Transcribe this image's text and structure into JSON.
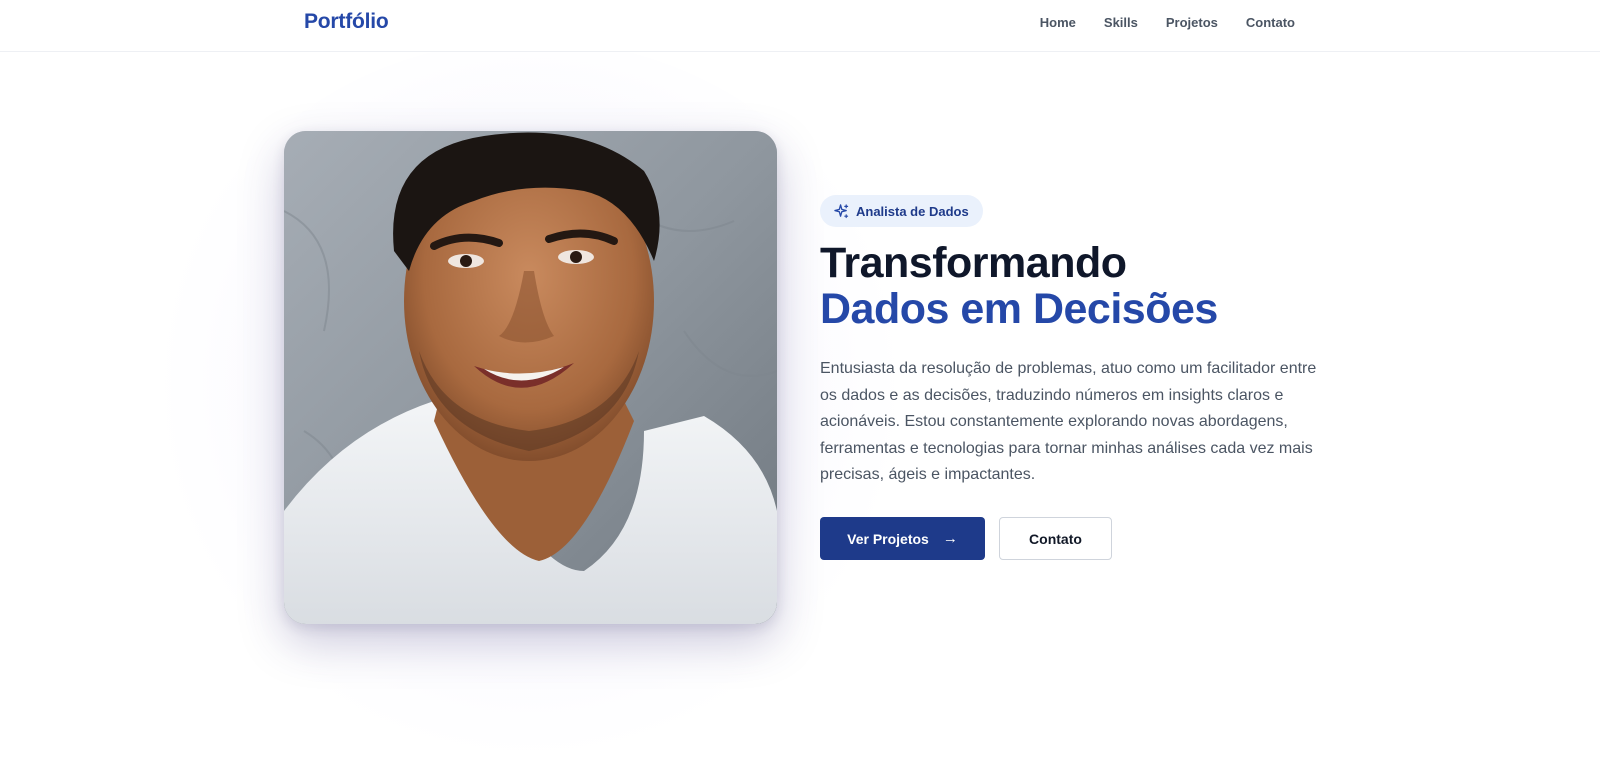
{
  "nav": {
    "logo": "Portfólio",
    "links": [
      "Home",
      "Skills",
      "Projetos",
      "Contato"
    ]
  },
  "hero": {
    "badge": "Analista de Dados",
    "badge_icon": "sparkle-icon",
    "title_line1": "Transformando",
    "title_line2": "Dados em Decisões",
    "description": "Entusiasta da resolução de problemas, atuo como um facilitador entre os dados e as decisões, traduzindo números em insights claros e acionáveis. Estou constantemente explorando novas abordagens, ferramentas e tecnologias para tornar minhas análises cada vez mais precisas, ágeis e impactantes.",
    "primary_button": "Ver Projetos",
    "primary_button_icon": "arrow-right-icon",
    "secondary_button": "Contato"
  },
  "colors": {
    "accent": "#2548a8",
    "primary_button": "#1e3a8a",
    "badge_bg": "#eaf1fc",
    "heading": "#0f172a",
    "body_text": "#4b5563"
  }
}
